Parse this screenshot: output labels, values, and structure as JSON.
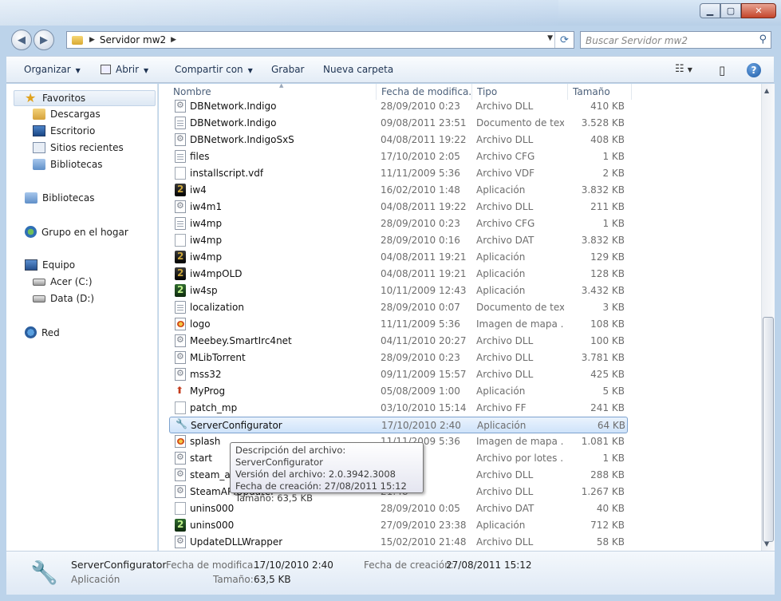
{
  "address": {
    "crumbs": [
      "Servidor mw2"
    ],
    "search_placeholder": "Buscar Servidor mw2"
  },
  "toolbar": {
    "organize": "Organizar",
    "open": "Abrir",
    "share": "Compartir con",
    "burn": "Grabar",
    "new_folder": "Nueva carpeta"
  },
  "sidebar": {
    "favorites": "Favoritos",
    "fav_items": [
      "Descargas",
      "Escritorio",
      "Sitios recientes",
      "Bibliotecas"
    ],
    "libraries": "Bibliotecas",
    "homegroup": "Grupo en el hogar",
    "computer": "Equipo",
    "drives": [
      "Acer (C:)",
      "Data (D:)"
    ],
    "network": "Red"
  },
  "columns": [
    "Nombre",
    "Fecha de modifica...",
    "Tipo",
    "Tamaño"
  ],
  "files": [
    {
      "name": "DBNetwork.Indigo",
      "date": "28/09/2010 0:23",
      "type": "Archivo DLL",
      "size": "410 KB",
      "icon": "gear"
    },
    {
      "name": "DBNetwork.Indigo",
      "date": "09/08/2011 23:51",
      "type": "Documento de tex...",
      "size": "3.528 KB",
      "icon": "file"
    },
    {
      "name": "DBNetwork.IndigoSxS",
      "date": "04/08/2011 19:22",
      "type": "Archivo DLL",
      "size": "408 KB",
      "icon": "gear"
    },
    {
      "name": "files",
      "date": "17/10/2010 2:05",
      "type": "Archivo CFG",
      "size": "1 KB",
      "icon": "file"
    },
    {
      "name": "installscript.vdf",
      "date": "11/11/2009 5:36",
      "type": "Archivo VDF",
      "size": "2 KB",
      "icon": "blank"
    },
    {
      "name": "iw4",
      "date": "16/02/2010 1:48",
      "type": "Aplicación",
      "size": "3.832 KB",
      "icon": "iw"
    },
    {
      "name": "iw4m1",
      "date": "04/08/2011 19:22",
      "type": "Archivo DLL",
      "size": "211 KB",
      "icon": "gear"
    },
    {
      "name": "iw4mp",
      "date": "28/09/2010 0:23",
      "type": "Archivo CFG",
      "size": "1 KB",
      "icon": "file"
    },
    {
      "name": "iw4mp",
      "date": "28/09/2010 0:16",
      "type": "Archivo DAT",
      "size": "3.832 KB",
      "icon": "blank"
    },
    {
      "name": "iw4mp",
      "date": "04/08/2011 19:21",
      "type": "Aplicación",
      "size": "129 KB",
      "icon": "iw"
    },
    {
      "name": "iw4mpOLD",
      "date": "04/08/2011 19:21",
      "type": "Aplicación",
      "size": "128 KB",
      "icon": "iw"
    },
    {
      "name": "iw4sp",
      "date": "10/11/2009 12:43",
      "type": "Aplicación",
      "size": "3.432 KB",
      "icon": "iwg"
    },
    {
      "name": "localization",
      "date": "28/09/2010 0:07",
      "type": "Documento de tex...",
      "size": "3 KB",
      "icon": "file"
    },
    {
      "name": "logo",
      "date": "11/11/2009 5:36",
      "type": "Imagen de mapa ...",
      "size": "108 KB",
      "icon": "img"
    },
    {
      "name": "Meebey.SmartIrc4net",
      "date": "04/11/2010 20:27",
      "type": "Archivo DLL",
      "size": "100 KB",
      "icon": "gear"
    },
    {
      "name": "MLibTorrent",
      "date": "28/09/2010 0:23",
      "type": "Archivo DLL",
      "size": "3.781 KB",
      "icon": "gear"
    },
    {
      "name": "mss32",
      "date": "09/11/2009 15:57",
      "type": "Archivo DLL",
      "size": "425 KB",
      "icon": "gear"
    },
    {
      "name": "MyProg",
      "date": "05/08/2009 1:00",
      "type": "Aplicación",
      "size": "5 KB",
      "icon": "myprog"
    },
    {
      "name": "patch_mp",
      "date": "03/10/2010 15:14",
      "type": "Archivo FF",
      "size": "241 KB",
      "icon": "blank"
    },
    {
      "name": "ServerConfigurator",
      "date": "17/10/2010 2:40",
      "type": "Aplicación",
      "size": "64 KB",
      "icon": "prog",
      "selected": true
    },
    {
      "name": "splash",
      "date": "11/11/2009 5:36",
      "type": "Imagen de mapa ...",
      "size": "1.081 KB",
      "icon": "img"
    },
    {
      "name": "start",
      "date": "19:23",
      "type": "Archivo por lotes ...",
      "size": "1 KB",
      "icon": "gear"
    },
    {
      "name": "steam_ap",
      "date": "11:58",
      "type": "Archivo DLL",
      "size": "288 KB",
      "icon": "gear"
    },
    {
      "name": "SteamAPIUpdater",
      "date": "21:48",
      "type": "Archivo DLL",
      "size": "1.267 KB",
      "icon": "gear"
    },
    {
      "name": "unins000",
      "date": "28/09/2010 0:05",
      "type": "Archivo DAT",
      "size": "40 KB",
      "icon": "blank"
    },
    {
      "name": "unins000",
      "date": "27/09/2010 23:38",
      "type": "Aplicación",
      "size": "712 KB",
      "icon": "iwg"
    },
    {
      "name": "UpdateDLLWrapper",
      "date": "15/02/2010 21:48",
      "type": "Archivo DLL",
      "size": "58 KB",
      "icon": "gear"
    }
  ],
  "tooltip": {
    "line1": "Descripción del archivo: ServerConfigurator",
    "line2": "Versión del archivo: 2.0.3942.3008",
    "line3": "Fecha de creación: 27/08/2011 15:12",
    "line4": "Tamaño: 63,5 KB"
  },
  "details": {
    "name": "ServerConfigurator",
    "type": "Aplicación",
    "modified_label": "Fecha de modifica...",
    "modified_value": "17/10/2010 2:40",
    "created_label": "Fecha de creación:",
    "created_value": "27/08/2011 15:12",
    "size_label": "Tamaño:",
    "size_value": "63,5 KB"
  }
}
